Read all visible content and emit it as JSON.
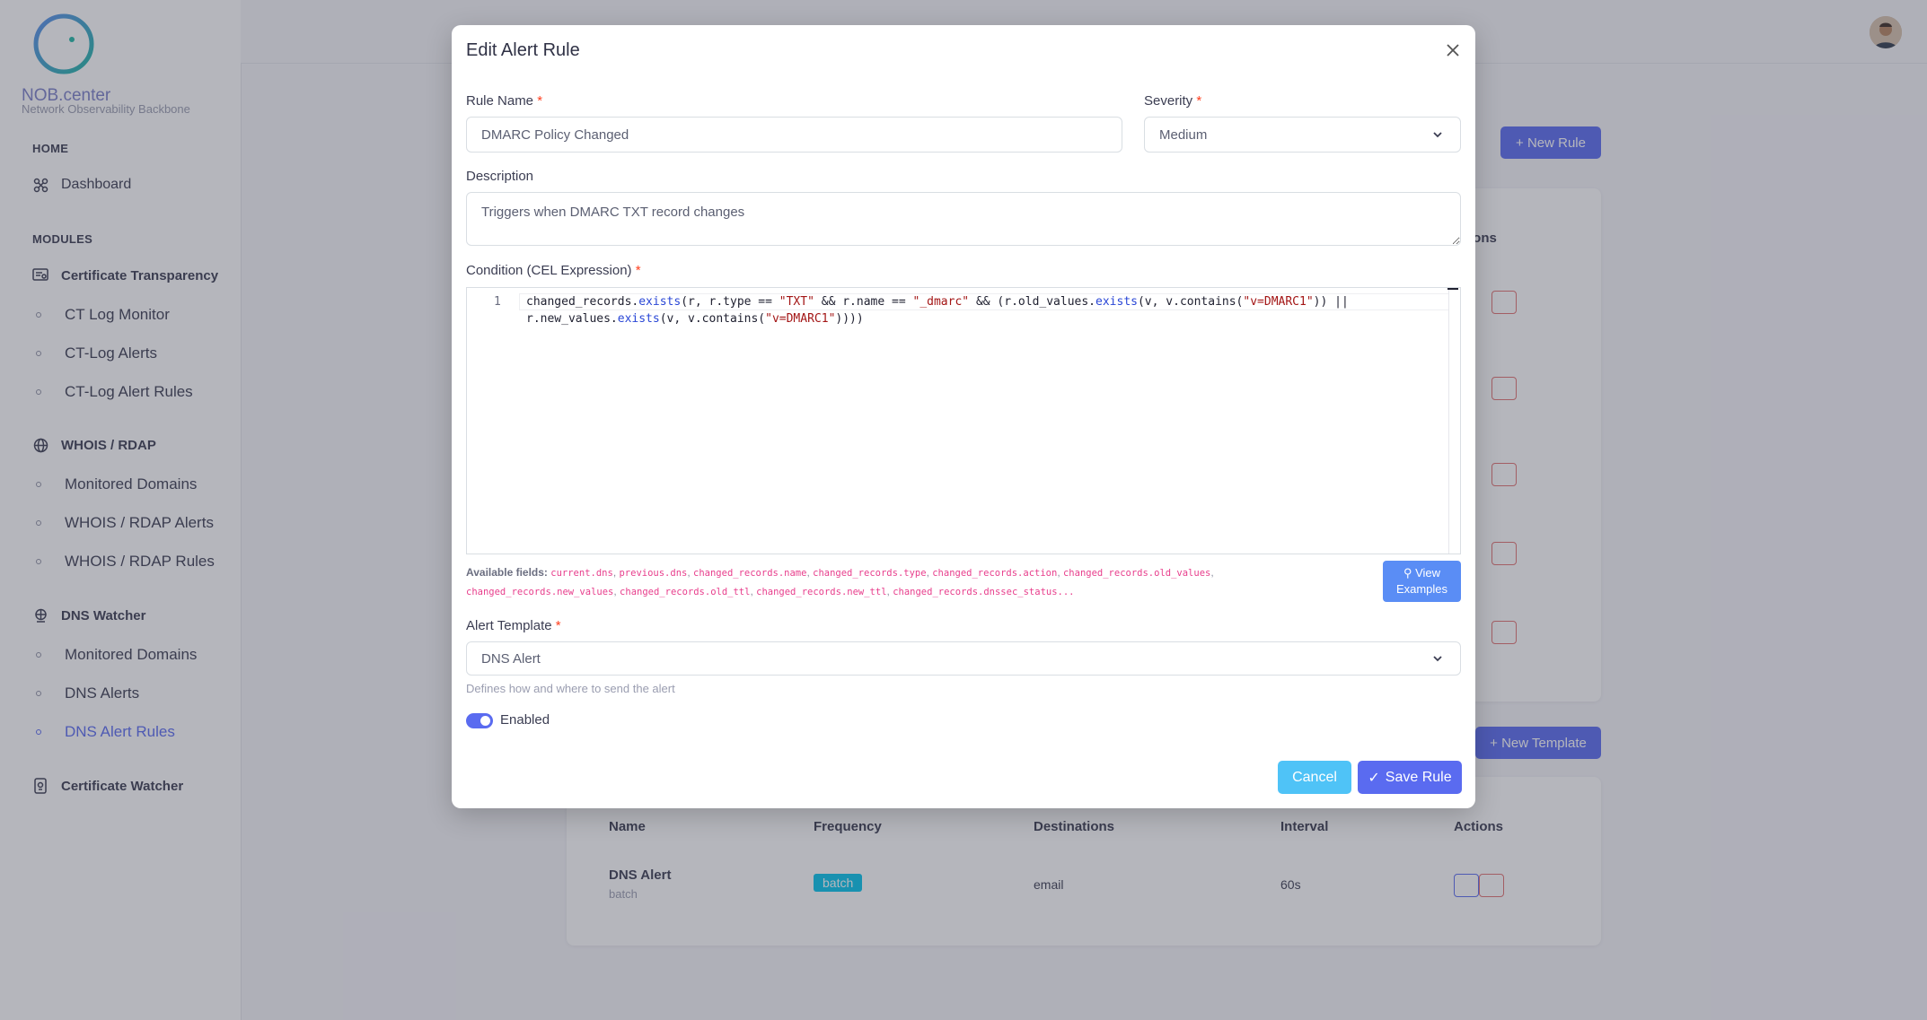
{
  "brand": {
    "name": "NOB.center",
    "tagline": "Network Observability Backbone"
  },
  "sidebar": {
    "home_header": "HOME",
    "dashboard": "Dashboard",
    "modules_header": "MODULES",
    "ct": {
      "label": "Certificate Transparency",
      "items": [
        "CT Log Monitor",
        "CT-Log Alerts",
        "CT-Log Alert Rules"
      ]
    },
    "whois": {
      "label": "WHOIS / RDAP",
      "items": [
        "Monitored Domains",
        "WHOIS / RDAP Alerts",
        "WHOIS / RDAP Rules"
      ]
    },
    "dns": {
      "label": "DNS Watcher",
      "items": [
        "Monitored Domains",
        "DNS Alerts",
        "DNS Alert Rules"
      ],
      "active": "DNS Alert Rules"
    },
    "certwatcher": {
      "label": "Certificate Watcher"
    }
  },
  "background": {
    "new_rule": "+ New Rule",
    "rules_actions_header": "ions",
    "new_template": "+ New Template",
    "templates_table": {
      "columns": [
        "Name",
        "Frequency",
        "Destinations",
        "Interval",
        "Actions"
      ],
      "rows": [
        {
          "name": "DNS Alert",
          "sub": "batch",
          "frequency": "batch",
          "destinations": "email",
          "interval": "60s"
        }
      ]
    }
  },
  "modal": {
    "title": "Edit Alert Rule",
    "rule_name_label": "Rule Name",
    "rule_name_value": "DMARC Policy Changed",
    "severity_label": "Severity",
    "severity_value": "Medium",
    "description_label": "Description",
    "description_value": "Triggers when DMARC TXT record changes",
    "condition_label": "Condition (CEL Expression)",
    "line_number": "1",
    "available_fields_label": "Available fields:",
    "available_fields": [
      "current.dns",
      "previous.dns",
      "changed_records.name",
      "changed_records.type",
      "changed_records.action",
      "changed_records.old_values",
      "changed_records.new_values",
      "changed_records.old_ttl",
      "changed_records.new_ttl",
      "changed_records.dnssec_status",
      "..."
    ],
    "view_examples": "View Examples",
    "template_label": "Alert Template",
    "template_value": "DNS Alert",
    "template_help": "Defines how and where to send the alert",
    "enabled_label": "Enabled",
    "enabled": true,
    "cancel": "Cancel",
    "save": "Save Rule"
  },
  "colors": {
    "primary": "#5a6bf0",
    "info": "#03c3ec",
    "danger": "#ff3e1d",
    "cancel": "#4fc3f7"
  }
}
